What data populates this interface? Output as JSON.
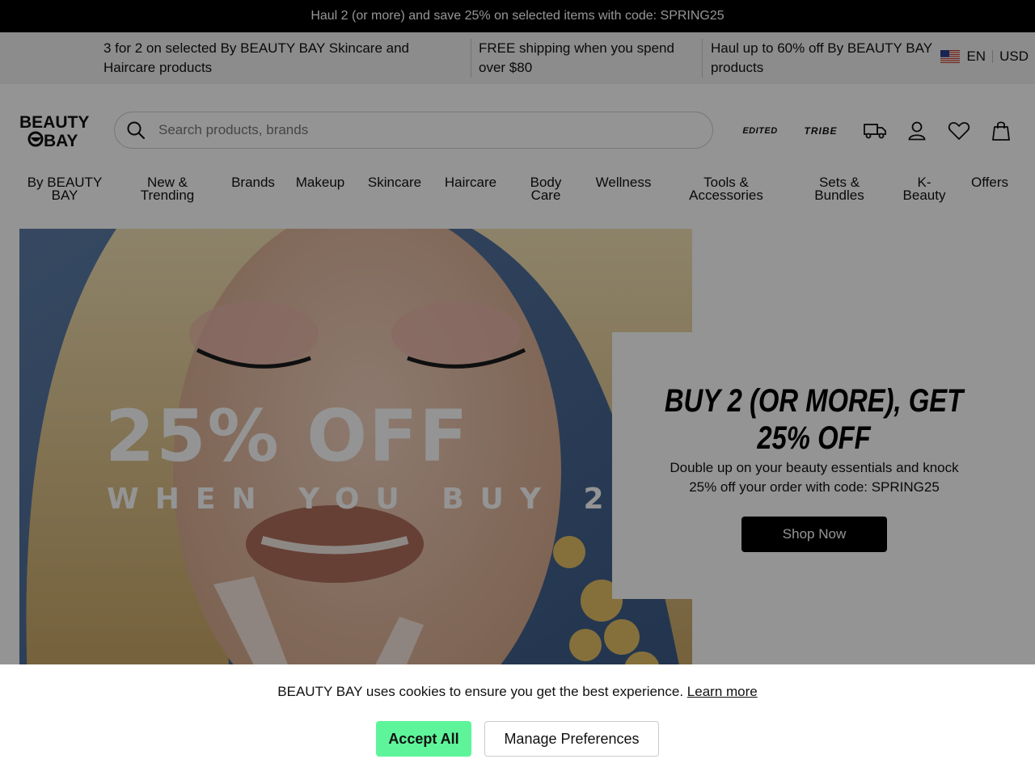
{
  "topbar": {
    "text": "Haul 2 (or more) and save 25% on selected items with code: SPRING25"
  },
  "promos": {
    "items": [
      "3 for 2 on selected By BEAUTY BAY Skincare and Haircare products",
      "FREE shipping when you spend over $80",
      "Haul up to 60% off By BEAUTY BAY products"
    ],
    "language": "EN",
    "currency": "USD"
  },
  "header": {
    "logo_line1": "BEAUTY",
    "logo_line2": "BAY",
    "search_placeholder": "Search products, brands",
    "edited_label": "EDITED",
    "tribe_label": "TRIBE"
  },
  "nav": {
    "items": [
      {
        "label": "By BEAUTY BAY"
      },
      {
        "label": "New & Trending"
      },
      {
        "label": "Brands"
      },
      {
        "label": "Makeup"
      },
      {
        "label": "Skincare"
      },
      {
        "label": "Haircare"
      },
      {
        "label": "Body Care"
      },
      {
        "label": "Wellness"
      },
      {
        "label": "Tools & Accessories"
      },
      {
        "label": "Sets & Bundles"
      },
      {
        "label": "K-Beauty"
      },
      {
        "label": "Offers"
      }
    ]
  },
  "hero": {
    "headline": "25% OFF",
    "subline": "WHEN YOU BUY 2"
  },
  "promo_card": {
    "title": "BUY 2 (OR MORE), GET 25% OFF",
    "description": "Double up on your beauty essentials and knock 25% off your order with code: SPRING25",
    "button": "Shop Now"
  },
  "cookie": {
    "text": "BEAUTY BAY uses cookies to ensure you get the best experience.",
    "link": "Learn more",
    "accept": "Accept All",
    "manage": "Manage Preferences"
  },
  "colors": {
    "accept_button": "#5ef59a",
    "overlay": "rgba(0,0,0,0.42)"
  }
}
